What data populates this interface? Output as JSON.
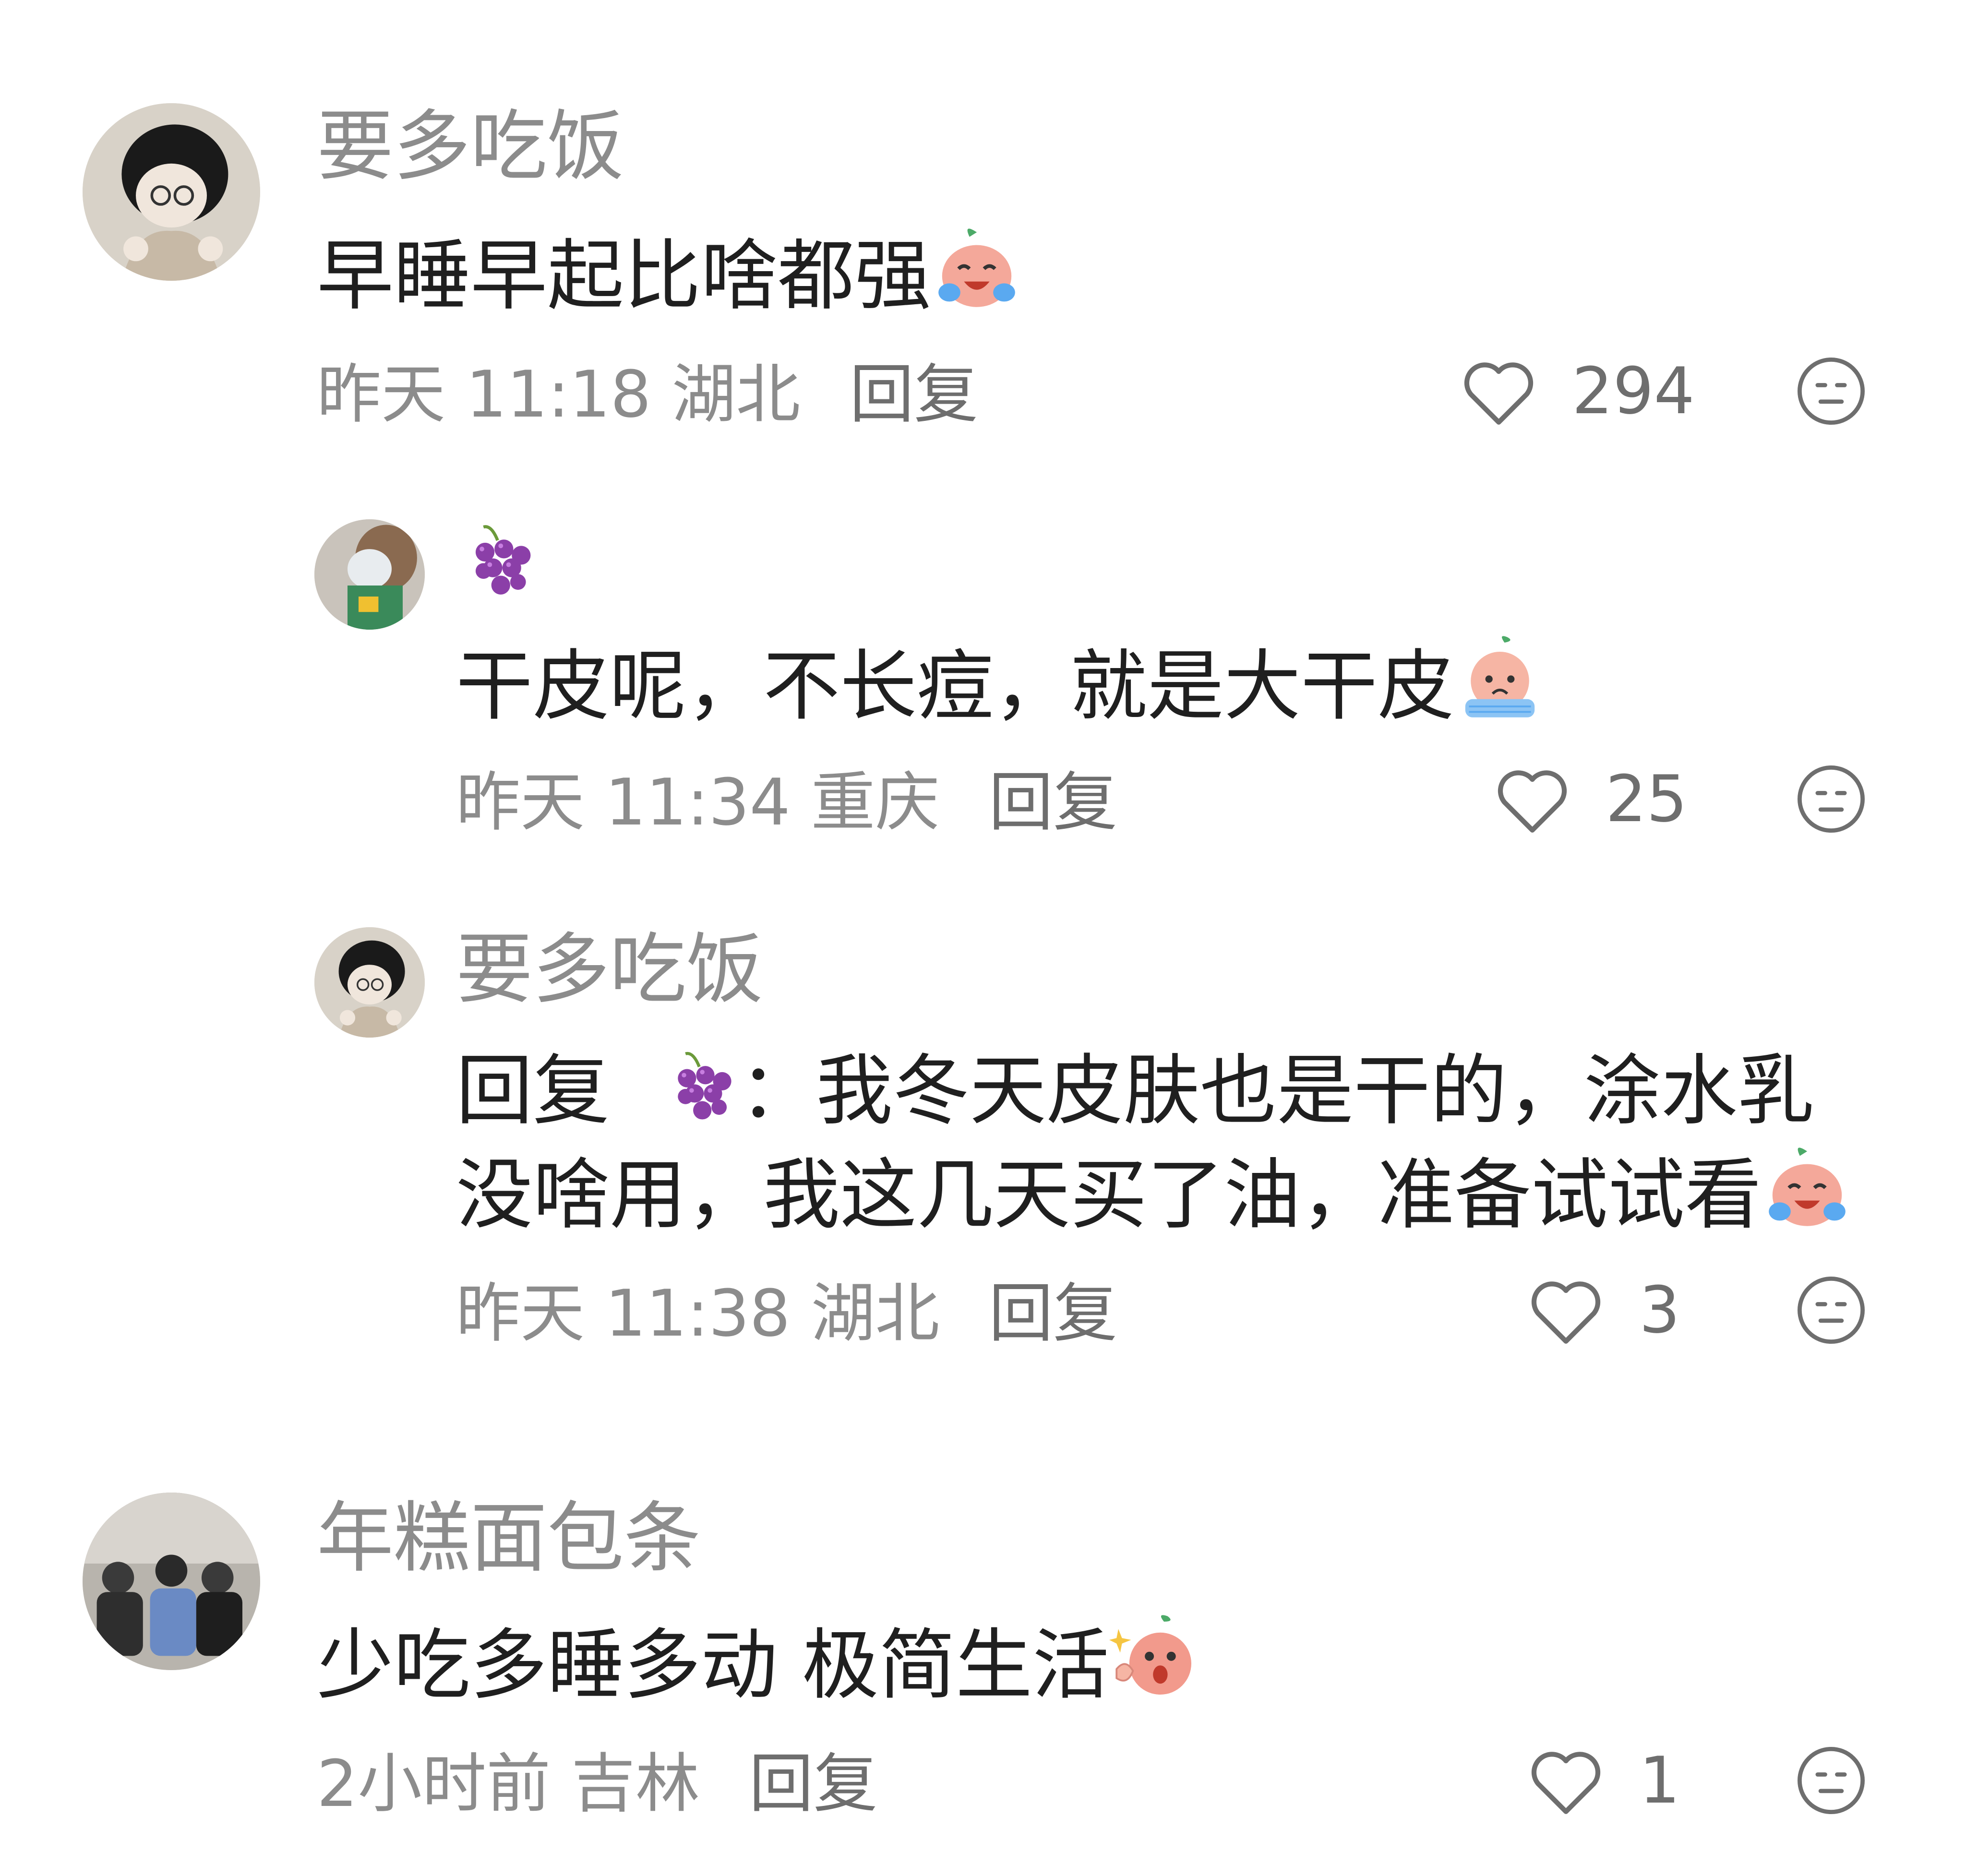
{
  "comments": [
    {
      "username": "要多吃饭",
      "text": "早睡早起比啥都强",
      "emoji": "crying-laugh-peach-emoji",
      "time": "昨天 11:18",
      "location": "湖北",
      "reply_label": "回复",
      "likes": "294",
      "replies": [
        {
          "username_icon": "grape-emoji",
          "text": "干皮呢，不长痘，就是大干皮",
          "emoji": "crying-peach-emoji",
          "time": "昨天 11:34",
          "location": "重庆",
          "reply_label": "回复",
          "likes": "25"
        },
        {
          "username": "要多吃饭",
          "reply_prefix": "回复",
          "reply_target_icon": "grape-emoji",
          "colon": "：",
          "text_line1": "我冬天皮肤也是干的，涂水乳",
          "text_line2": "没啥用，我这几天买了油，准备试试看",
          "emoji": "crying-laugh-peach-emoji",
          "time": "昨天 11:38",
          "location": "湖北",
          "reply_label": "回复",
          "likes": "3"
        }
      ]
    },
    {
      "username": "年糕面包条",
      "text": "少吃多睡多动 极简生活",
      "emoji": "shocked-peach-emoji",
      "time": "2小时前",
      "location": "吉林",
      "reply_label": "回复",
      "likes": "1"
    }
  ],
  "colors": {
    "username": "#8c8c8c",
    "text": "#1f1f1f",
    "meta": "#8c8c8c",
    "icon": "#6e6e6e"
  }
}
